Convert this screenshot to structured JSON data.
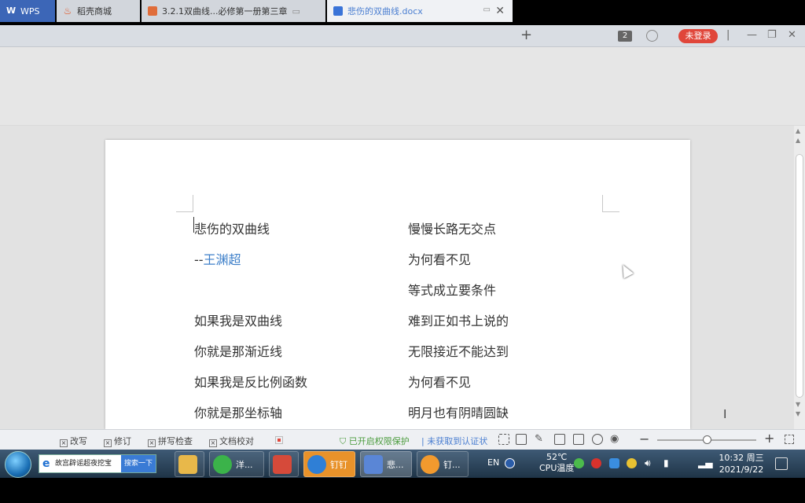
{
  "tabs": {
    "wps": "WPS",
    "shop": "稻壳商城",
    "ppt": "3.2.1双曲线...必修第一册第三章",
    "doc": "悲伤的双曲线.docx"
  },
  "header": {
    "window_count": "2",
    "login_label": "未登录"
  },
  "document": {
    "title": "悲伤的双曲线",
    "author_dash": "--",
    "author_name": "王渊超",
    "left_lines": [
      "如果我是双曲线",
      "你就是那渐近线",
      "如果我是反比例函数",
      "你就是那坐标轴"
    ],
    "right_lines": [
      "慢慢长路无交点",
      "为何看不见",
      "等式成立要条件",
      "难到正如书上说的",
      "无限接近不能达到",
      "为何看不见",
      "明月也有阴晴圆缺"
    ]
  },
  "statusbar": {
    "revise": "改写",
    "track": "修订",
    "spell": "拼写检查",
    "proof": "文档校对",
    "permission": "已开启权限保护",
    "cert": "未获取到认证状",
    "zoom_level": 0.5
  },
  "taskbar": {
    "ie_text": "故宫辟谣超夜挖宝",
    "ie_go": "搜索一下",
    "items": [
      "洋...",
      "钉钉",
      "悲...",
      "钉..."
    ],
    "lang": "EN",
    "temp": "52℃",
    "temp_label": "CPU温度",
    "time": "10:32 周三",
    "date": "2021/9/22"
  },
  "colors": {
    "accent": "#3c66b7",
    "login": "#e0463a",
    "author": "#3d7fc9",
    "permission": "#4a9b3c"
  }
}
